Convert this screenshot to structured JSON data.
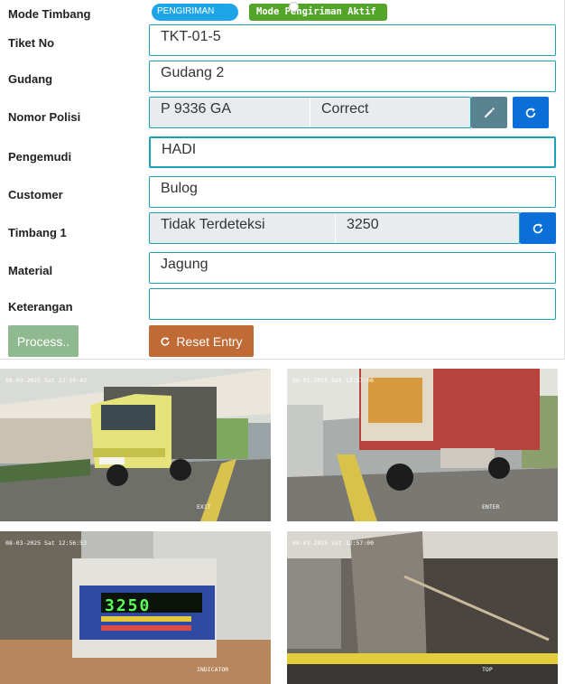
{
  "labels": {
    "mode_timbang": "Mode Timbang",
    "tiket_no": "Tiket No",
    "gudang": "Gudang",
    "nomor_polisi": "Nomor Polisi",
    "pengemudi": "Pengemudi",
    "customer": "Customer",
    "timbang_1": "Timbang 1",
    "material": "Material",
    "keterangan": "Keterangan"
  },
  "mode": {
    "toggle_label": "PENGIRIMAN",
    "status_badge": "Mode Pengiriman Aktif"
  },
  "fields": {
    "tiket_no": "TKT-01-5",
    "gudang": "Gudang 2",
    "nomor_polisi": "P 9336 GA",
    "nomor_polisi_status": "Correct",
    "pengemudi": "HADI",
    "customer": "Bulog",
    "timbang_status": "Tidak Terdeteksi",
    "timbang_value": "3250",
    "material": "Jagung",
    "keterangan": ""
  },
  "buttons": {
    "process": "Process..",
    "reset": "Reset Entry"
  },
  "cameras": [
    {
      "timestamp": "08-03-2025 Sat 12:56:43",
      "caption": "EXIT"
    },
    {
      "timestamp": "08-03-2025 Sat 12:57:06",
      "caption": "ENTER"
    },
    {
      "timestamp": "08-03-2025 Sat 12:56:53",
      "caption": "INDICATOR"
    },
    {
      "timestamp": "08-03-2025 Sat 12:57:00",
      "caption": "TOP"
    }
  ],
  "indicator_display": "3250",
  "colors": {
    "field_border": "#17a2b8",
    "mode_pill": "#1ea5e8",
    "status_badge": "#53a52a",
    "edit_button": "#5a8392",
    "refresh_button": "#0a6fd8",
    "process_button": "#6aa36a",
    "reset_button": "#c06a35"
  }
}
